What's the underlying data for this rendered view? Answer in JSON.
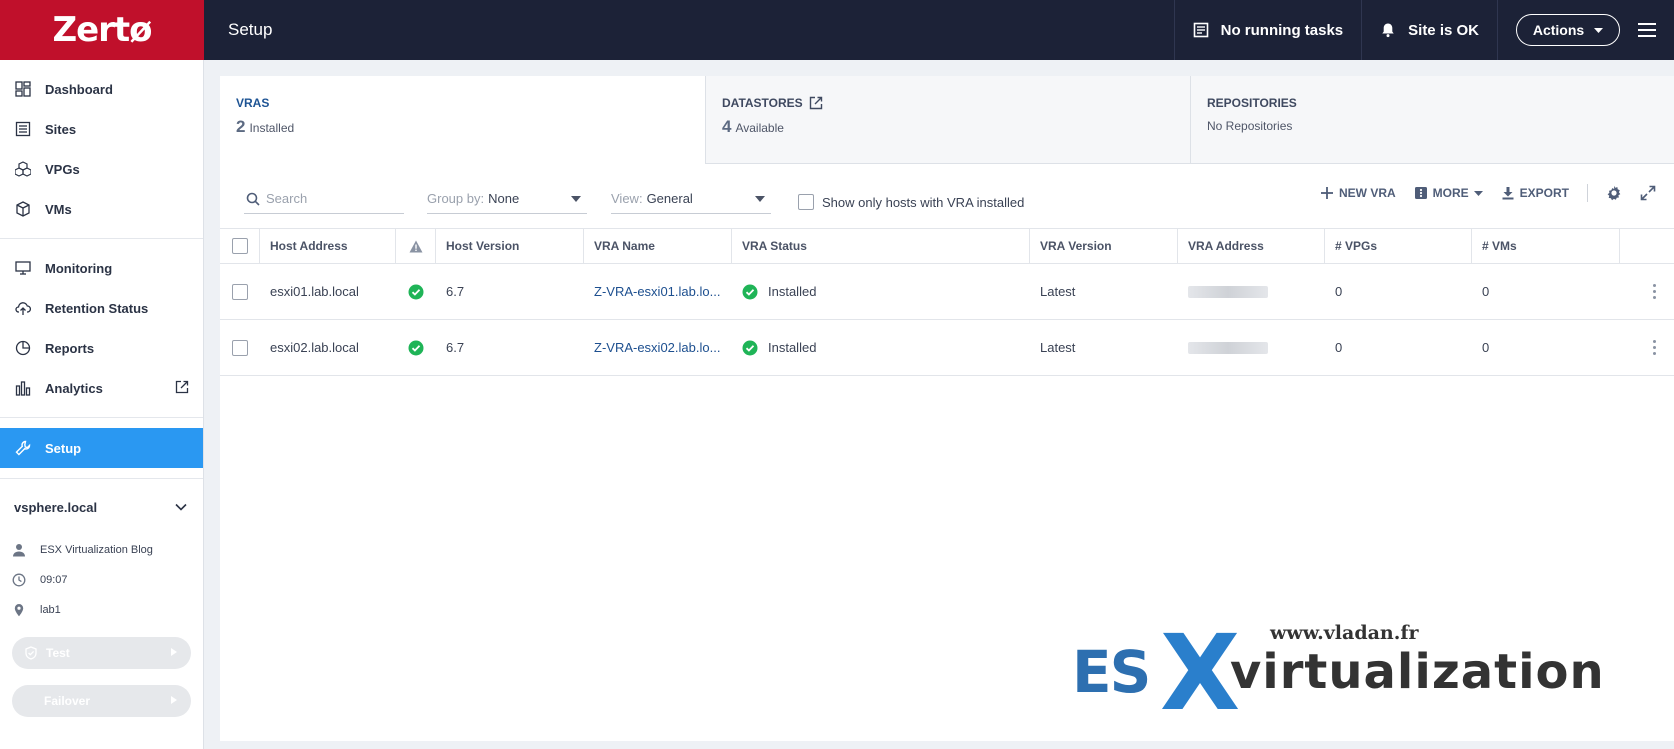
{
  "brand": {
    "name": "Zertø"
  },
  "header": {
    "title": "Setup",
    "tasks": "No running tasks",
    "site_status": "Site is OK",
    "actions_label": "Actions"
  },
  "sidebar": {
    "nav_primary": [
      {
        "label": "Dashboard",
        "icon": "dashboard-icon"
      },
      {
        "label": "Sites",
        "icon": "sites-icon"
      },
      {
        "label": "VPGs",
        "icon": "vpgs-icon"
      },
      {
        "label": "VMs",
        "icon": "vms-icon"
      }
    ],
    "nav_secondary": [
      {
        "label": "Monitoring",
        "icon": "monitor-icon"
      },
      {
        "label": "Retention Status",
        "icon": "cloud-upload-icon"
      },
      {
        "label": "Reports",
        "icon": "reports-icon"
      },
      {
        "label": "Analytics",
        "icon": "analytics-icon"
      }
    ],
    "active": {
      "label": "Setup",
      "icon": "wrench-icon"
    },
    "site_name": "vsphere.local",
    "user": "ESX Virtualization Blog",
    "time": "09:07",
    "location": "lab1",
    "test_label": "Test",
    "failover_label": "Failover"
  },
  "cards": [
    {
      "title": "VRAS",
      "count": "2",
      "suffix": "Installed"
    },
    {
      "title": "DATASTORES",
      "count": "4",
      "suffix": "Available"
    },
    {
      "title": "REPOSITORIES",
      "count": "",
      "suffix": "No Repositories"
    }
  ],
  "toolbar": {
    "search_placeholder": "Search",
    "group_by_label": "Group by:",
    "group_by_value": "None",
    "view_label": "View:",
    "view_value": "General",
    "show_only_label": "Show only hosts with VRA installed",
    "new_vra": "NEW VRA",
    "more": "MORE",
    "export": "EXPORT"
  },
  "table": {
    "columns": [
      "Host Address",
      "Host Version",
      "VRA Name",
      "VRA Status",
      "VRA Version",
      "VRA Address",
      "# VPGs",
      "# VMs"
    ],
    "rows": [
      {
        "host": "esxi01.lab.local",
        "host_version": "6.7",
        "vra_name": "Z-VRA-esxi01.lab.lo...",
        "vra_status": "Installed",
        "vra_version": "Latest",
        "vpgs": "0",
        "vms": "0"
      },
      {
        "host": "esxi02.lab.local",
        "host_version": "6.7",
        "vra_name": "Z-VRA-esxi02.lab.lo...",
        "vra_status": "Installed",
        "vra_version": "Latest",
        "vpgs": "0",
        "vms": "0"
      }
    ]
  },
  "watermark": {
    "url": "www.vladan.fr",
    "es": "ES",
    "x": "X",
    "virtualization": "virtualization"
  },
  "colors": {
    "brand_red": "#c0102b",
    "topbar": "#1c2237",
    "active_nav": "#2a98f2",
    "success": "#1fb457",
    "link": "#1d4f8f"
  }
}
